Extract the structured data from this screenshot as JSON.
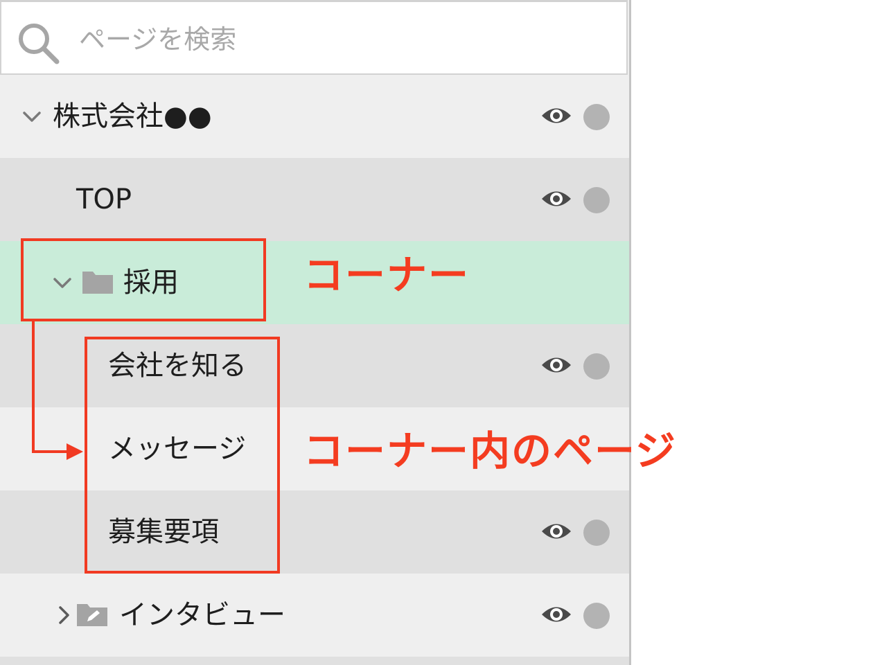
{
  "search": {
    "placeholder": "ページを検索"
  },
  "tree": {
    "site": {
      "label": "株式会社●●",
      "expanded": true
    },
    "top_page": {
      "label": "TOP"
    },
    "corner": {
      "label": "採用",
      "expanded": true,
      "icon": "folder-icon"
    },
    "corner_pages": [
      {
        "label": "会社を知る"
      },
      {
        "label": "メッセージ"
      },
      {
        "label": "募集要項"
      }
    ],
    "interview_corner": {
      "label": "インタビュー",
      "expanded": false,
      "icon": "folder-edit-icon"
    }
  },
  "annotations": {
    "corner_label": "コーナー",
    "corner_pages_label": "コーナー内のページ"
  },
  "colors": {
    "annotation": "#f13a22",
    "active_row": "#c9ecd9",
    "row_light": "#efefef",
    "row_dark": "#e0e0e0",
    "status_dot": "#b3b3b3"
  }
}
